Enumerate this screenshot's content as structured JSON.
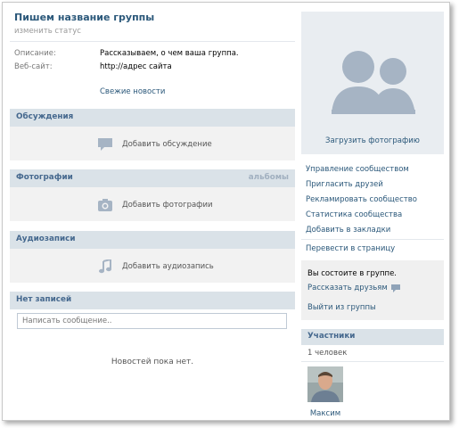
{
  "group": {
    "name": "Пишем название группы",
    "status_link": "изменить статус"
  },
  "info": {
    "description_label": "Описание:",
    "description_value": "Рассказываем, о чем ваша группа.",
    "website_label": "Веб-сайт:",
    "website_value": "http://адрес сайта",
    "news_link": "Свежие новости"
  },
  "sections": {
    "discussions": {
      "title": "Обсуждения",
      "action": "Добавить обсуждение"
    },
    "photos": {
      "title": "Фотографии",
      "extra": "альбомы",
      "action": "Добавить фотографии"
    },
    "audio": {
      "title": "Аудиозаписи",
      "action": "Добавить аудиозапись"
    },
    "posts": {
      "title": "Нет записей"
    }
  },
  "wall": {
    "input_placeholder": "Написать сообщение..",
    "empty_text": "Новостей пока нет."
  },
  "sidebar": {
    "upload_photo": "Загрузить фотографию",
    "menu": [
      "Управление сообществом",
      "Пригласить друзей",
      "Рекламировать сообщество",
      "Статистика сообщества",
      "Добавить в закладки"
    ],
    "convert": "Перевести в страницу",
    "membership": {
      "text": "Вы состоите в группе.",
      "share": "Рассказать друзьям",
      "leave": "Выйти из группы"
    },
    "members": {
      "title": "Участники",
      "count": "1 человек",
      "items": [
        {
          "name": "Максим"
        }
      ]
    }
  },
  "colors": {
    "link": "#2b587a",
    "header_bg": "#dae2e8",
    "header_text": "#45688e",
    "section_bg": "#f2f2f2",
    "placeholder_silhouette": "#a6b4c4"
  },
  "icons": {
    "discussions": "speech-bubble-icon",
    "photos": "camera-icon",
    "audio": "music-note-icon",
    "share": "speech-bubble-icon",
    "group_placeholder": "people-silhouette-icon"
  }
}
